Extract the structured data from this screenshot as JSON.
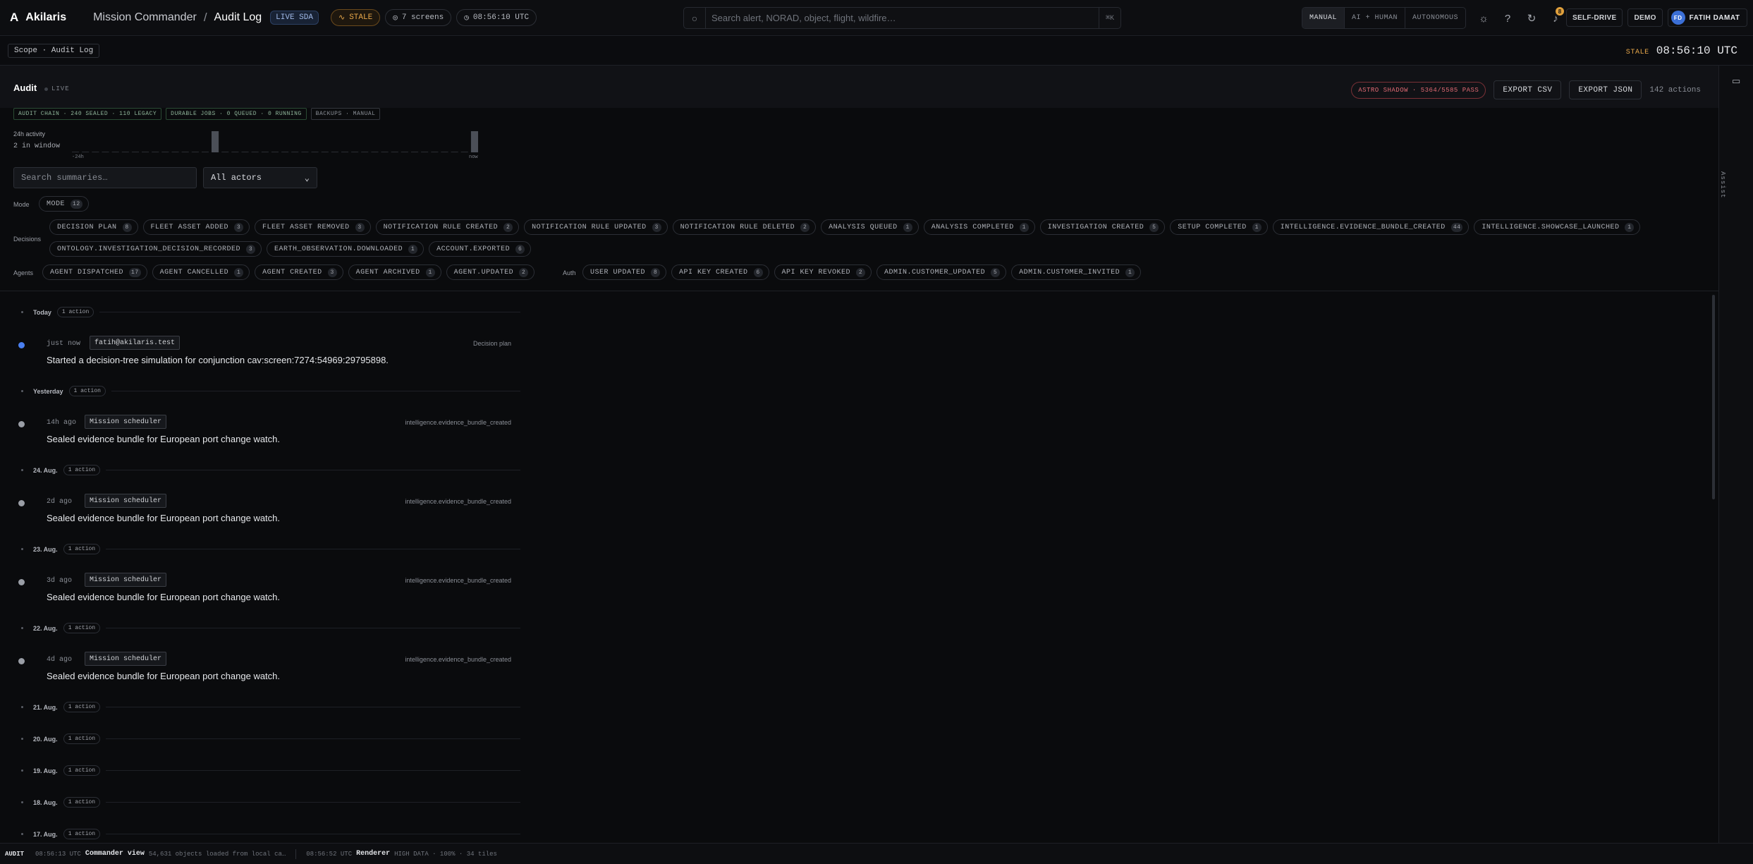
{
  "app": {
    "name": "Akilaris",
    "logo": "A"
  },
  "breadcrumb": {
    "parent": "Mission Commander",
    "separator": "/",
    "current": "Audit Log"
  },
  "top": {
    "live_badge": "LIVE SDA",
    "stale": "STALE",
    "screens": "7 screens",
    "time": "08:56:10 UTC",
    "search_placeholder": "Search alert, NORAD, object, flight, wildfire…",
    "search_kbd": "⌘K",
    "modes": [
      "MANUAL",
      "AI + HUMAN",
      "AUTONOMOUS"
    ],
    "active_mode": "MANUAL",
    "notif_count": "8",
    "self_drive": "SELF-DRIVE",
    "demo": "DEMO",
    "user_initials": "FD",
    "user_name": "FATIH DAMAT"
  },
  "scope": {
    "label": "Scope · Audit Log",
    "stale": "STALE",
    "clock": "08:56:10 UTC"
  },
  "rail": {
    "label": "Assist"
  },
  "header": {
    "title": "Audit",
    "live": "LIVE",
    "astro": "ASTRO SHADOW · 5364/5585 PASS",
    "export_csv": "EXPORT CSV",
    "export_json": "EXPORT JSON",
    "count": "142 actions"
  },
  "status_chips": [
    "AUDIT CHAIN · 240 SEALED · 110 LEGACY",
    "DURABLE JOBS · 0 QUEUED · 0 RUNNING",
    "BACKUPS · MANUAL"
  ],
  "activity": {
    "label": "24h activity",
    "sub": "2 in window",
    "start": "-24h",
    "end": "now",
    "buckets": [
      0,
      0,
      0,
      0,
      0,
      0,
      0,
      0,
      0,
      0,
      0,
      0,
      0,
      0,
      1,
      0,
      0,
      0,
      0,
      0,
      0,
      0,
      0,
      0,
      0,
      0,
      0,
      0,
      0,
      0,
      0,
      0,
      0,
      0,
      0,
      0,
      0,
      0,
      0,
      0,
      1
    ]
  },
  "filters": {
    "search_placeholder": "Search summaries…",
    "actor_value": "All actors"
  },
  "groups": {
    "mode": {
      "label": "Mode",
      "tags": [
        {
          "t": "MODE",
          "n": "12"
        }
      ]
    },
    "decisions": {
      "label": "Decisions",
      "tags": [
        {
          "t": "DECISION PLAN",
          "n": "8"
        },
        {
          "t": "FLEET ASSET ADDED",
          "n": "3"
        },
        {
          "t": "FLEET ASSET REMOVED",
          "n": "3"
        },
        {
          "t": "NOTIFICATION RULE CREATED",
          "n": "2"
        },
        {
          "t": "NOTIFICATION RULE UPDATED",
          "n": "3"
        },
        {
          "t": "NOTIFICATION RULE DELETED",
          "n": "2"
        },
        {
          "t": "ANALYSIS QUEUED",
          "n": "1"
        },
        {
          "t": "ANALYSIS COMPLETED",
          "n": "1"
        },
        {
          "t": "INVESTIGATION CREATED",
          "n": "5"
        },
        {
          "t": "SETUP COMPLETED",
          "n": "1"
        },
        {
          "t": "INTELLIGENCE.EVIDENCE_BUNDLE_CREATED",
          "n": "44"
        },
        {
          "t": "INTELLIGENCE.SHOWCASE_LAUNCHED",
          "n": "1"
        },
        {
          "t": "ONTOLOGY.INVESTIGATION_DECISION_RECORDED",
          "n": "3"
        },
        {
          "t": "EARTH_OBSERVATION.DOWNLOADED",
          "n": "1"
        },
        {
          "t": "ACCOUNT.EXPORTED",
          "n": "6"
        }
      ]
    },
    "agents": {
      "label": "Agents",
      "tags": [
        {
          "t": "AGENT DISPATCHED",
          "n": "17"
        },
        {
          "t": "AGENT CANCELLED",
          "n": "1"
        },
        {
          "t": "AGENT CREATED",
          "n": "3"
        },
        {
          "t": "AGENT ARCHIVED",
          "n": "1"
        },
        {
          "t": "AGENT.UPDATED",
          "n": "2"
        }
      ]
    },
    "auth": {
      "label": "Auth",
      "tags": [
        {
          "t": "USER UPDATED",
          "n": "8"
        },
        {
          "t": "API KEY CREATED",
          "n": "6"
        },
        {
          "t": "API KEY REVOKED",
          "n": "2"
        },
        {
          "t": "ADMIN.CUSTOMER_UPDATED",
          "n": "5"
        },
        {
          "t": "ADMIN.CUSTOMER_INVITED",
          "n": "1"
        }
      ]
    }
  },
  "timeline": [
    {
      "day": "Today",
      "count": "1 action",
      "entries": [
        {
          "when": "just now",
          "actor": "fatih@akilaris.test",
          "kind": "Decision plan",
          "summary": "Started a decision-tree simulation for conjunction cav:screen:7274:54969:29795898.",
          "highlight": true
        }
      ]
    },
    {
      "day": "Yesterday",
      "count": "1 action",
      "entries": [
        {
          "when": "14h ago",
          "actor": "Mission scheduler",
          "kind": "intelligence.evidence_bundle_created",
          "summary": "Sealed evidence bundle for European port change watch."
        }
      ]
    },
    {
      "day": "24. Aug.",
      "count": "1 action",
      "entries": [
        {
          "when": "2d ago",
          "actor": "Mission scheduler",
          "kind": "intelligence.evidence_bundle_created",
          "summary": "Sealed evidence bundle for European port change watch."
        }
      ]
    },
    {
      "day": "23. Aug.",
      "count": "1 action",
      "entries": [
        {
          "when": "3d ago",
          "actor": "Mission scheduler",
          "kind": "intelligence.evidence_bundle_created",
          "summary": "Sealed evidence bundle for European port change watch."
        }
      ]
    },
    {
      "day": "22. Aug.",
      "count": "1 action",
      "entries": [
        {
          "when": "4d ago",
          "actor": "Mission scheduler",
          "kind": "intelligence.evidence_bundle_created",
          "summary": "Sealed evidence bundle for European port change watch."
        }
      ]
    },
    {
      "day": "21. Aug.",
      "count": "1 action",
      "entries": []
    },
    {
      "day": "20. Aug.",
      "count": "1 action",
      "entries": []
    },
    {
      "day": "19. Aug.",
      "count": "1 action",
      "entries": []
    },
    {
      "day": "18. Aug.",
      "count": "1 action",
      "entries": []
    },
    {
      "day": "17. Aug.",
      "count": "1 action",
      "entries": []
    }
  ],
  "statusbar": {
    "section": "AUDIT",
    "t1": "08:56:13 UTC",
    "v1": "Commander view",
    "m1": "54,631 objects loaded from local ca…",
    "t2": "08:56:52 UTC",
    "v2": "Renderer",
    "m2": "HIGH DATA · 100% · 34 tiles"
  }
}
